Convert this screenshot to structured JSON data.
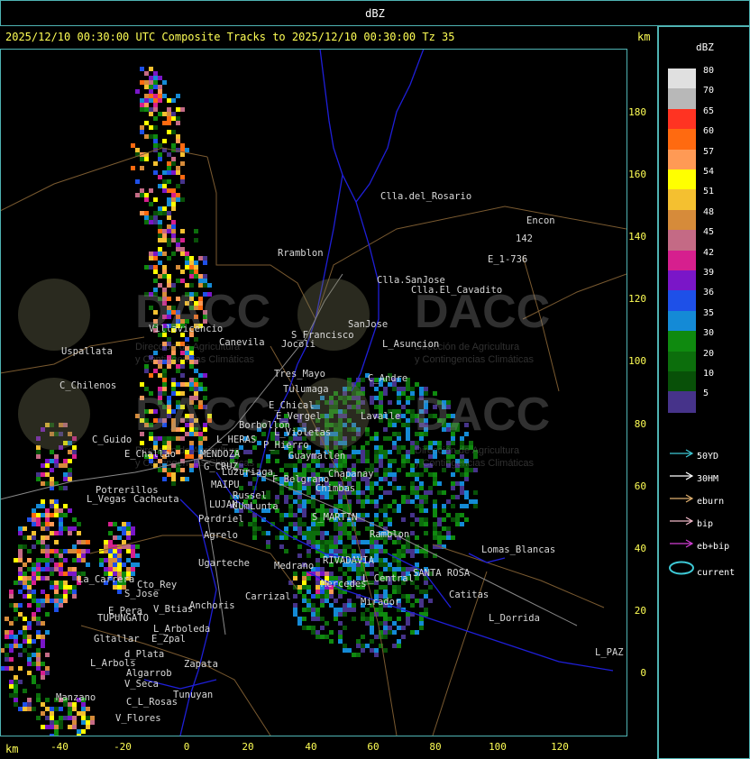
{
  "header": {
    "title": "dBZ"
  },
  "plot": {
    "title": "2025/12/10 00:30:00 UTC Composite Tracks to 2025/12/10 00:30:00 Tz 35",
    "km_label_top": "km",
    "km_label_bottom": "km",
    "y_ticks": [
      "180",
      "160",
      "140",
      "120",
      "100",
      "80",
      "60",
      "40",
      "20",
      "0"
    ],
    "x_ticks": [
      "-40",
      "-20",
      "0",
      "20",
      "40",
      "60",
      "80",
      "100",
      "120"
    ]
  },
  "legend": {
    "title": "dBZ",
    "levels": [
      {
        "value": "80",
        "color": "#e0e0e0"
      },
      {
        "value": "70",
        "color": "#b8b8b8"
      },
      {
        "value": "65",
        "color": "#ff3322"
      },
      {
        "value": "60",
        "color": "#ff6a10"
      },
      {
        "value": "57",
        "color": "#ff9a55"
      },
      {
        "value": "54",
        "color": "#ffff00"
      },
      {
        "value": "51",
        "color": "#f4c030"
      },
      {
        "value": "48",
        "color": "#d68b3a"
      },
      {
        "value": "45",
        "color": "#c46a85"
      },
      {
        "value": "42",
        "color": "#d61f8e"
      },
      {
        "value": "39",
        "color": "#7a16c8"
      },
      {
        "value": "36",
        "color": "#1e50e8"
      },
      {
        "value": "35",
        "color": "#148ad6"
      },
      {
        "value": "30",
        "color": "#0f8a0f"
      },
      {
        "value": "20",
        "color": "#0c6e0c"
      },
      {
        "value": "10",
        "color": "#085008"
      },
      {
        "value": "5",
        "color": "#46338a"
      }
    ],
    "tracks": [
      {
        "label": "50YD",
        "color": "#3ec9d6"
      },
      {
        "label": "30HM",
        "color": "#ffffff"
      },
      {
        "label": "eburn",
        "color": "#e0b070"
      },
      {
        "label": "bip",
        "color": "#f0b8c8"
      },
      {
        "label": "eb+bip",
        "color": "#d23fd6"
      },
      {
        "label": "current",
        "color": "#3ec9d6"
      }
    ]
  },
  "watermark": {
    "text": "DACC",
    "subtitle_1": "Dirección de Agricultura",
    "subtitle_2": "y Contingencias Climáticas"
  },
  "places": [
    {
      "name": "Clla.del_Rosario"
    },
    {
      "name": "Encon"
    },
    {
      "name": "142"
    },
    {
      "name": "E_1-736"
    },
    {
      "name": "Rramblon"
    },
    {
      "name": "Clla.SanJose"
    },
    {
      "name": "Clla.El_Cavadito"
    },
    {
      "name": "Villavicencio"
    },
    {
      "name": "Canevila"
    },
    {
      "name": "S_Francisco"
    },
    {
      "name": "SanJose"
    },
    {
      "name": "L_Asuncion"
    },
    {
      "name": "Jocoli"
    },
    {
      "name": "Uspallata"
    },
    {
      "name": "C_Chilenos"
    },
    {
      "name": "Tres_Mayo"
    },
    {
      "name": "Tulumaga"
    },
    {
      "name": "C_Andre"
    },
    {
      "name": "E_Chical"
    },
    {
      "name": "E_Vergel"
    },
    {
      "name": "Borbollon"
    },
    {
      "name": "Lavalle"
    },
    {
      "name": "L_Violetas"
    },
    {
      "name": "P_Hierro"
    },
    {
      "name": "C_Guido"
    },
    {
      "name": "L_HERAS"
    },
    {
      "name": "MENDOZA"
    },
    {
      "name": "E_Challao"
    },
    {
      "name": "G_CRUZ"
    },
    {
      "name": "Guaymallen"
    },
    {
      "name": "Luzuriaga"
    },
    {
      "name": "Potrerillos"
    },
    {
      "name": "MAIPU"
    },
    {
      "name": "Russel"
    },
    {
      "name": "L_Vegas"
    },
    {
      "name": "Cacheuta"
    },
    {
      "name": "LUJAN"
    },
    {
      "name": "CUmLunta"
    },
    {
      "name": "Perdriel"
    },
    {
      "name": "Agrelo"
    },
    {
      "name": "Ugarteche"
    },
    {
      "name": "S_MARTIN"
    },
    {
      "name": "Chapanay"
    },
    {
      "name": "Ramblon"
    },
    {
      "name": "Lomas_Blancas"
    },
    {
      "name": "La_Carrera"
    },
    {
      "name": "Cto_Rey"
    },
    {
      "name": "S_Jose"
    },
    {
      "name": "Carrizal"
    },
    {
      "name": "RIVADAVIA"
    },
    {
      "name": "SANTA ROSA"
    },
    {
      "name": "Catitas"
    },
    {
      "name": "E_Pera"
    },
    {
      "name": "V_Btias"
    },
    {
      "name": "TUPUNGATO"
    },
    {
      "name": "Anchoris"
    },
    {
      "name": "L_Arboleda"
    },
    {
      "name": "Gltallar"
    },
    {
      "name": "E_Zpal"
    },
    {
      "name": "Mirador"
    },
    {
      "name": "L_Dorrida"
    },
    {
      "name": "L_Arbols"
    },
    {
      "name": "d_Plata"
    },
    {
      "name": "Zapata"
    },
    {
      "name": "Algarrob"
    },
    {
      "name": "V_Seca"
    },
    {
      "name": "Tunuyan"
    },
    {
      "name": "Manzano"
    },
    {
      "name": "C_L_Rosas"
    },
    {
      "name": "V_Flores"
    },
    {
      "name": "L_PAZ"
    },
    {
      "name": "Medrano"
    },
    {
      "name": "L_Central"
    },
    {
      "name": "Mercedes"
    },
    {
      "name": "Chimbas"
    },
    {
      "name": "F_Belgrano"
    }
  ]
}
